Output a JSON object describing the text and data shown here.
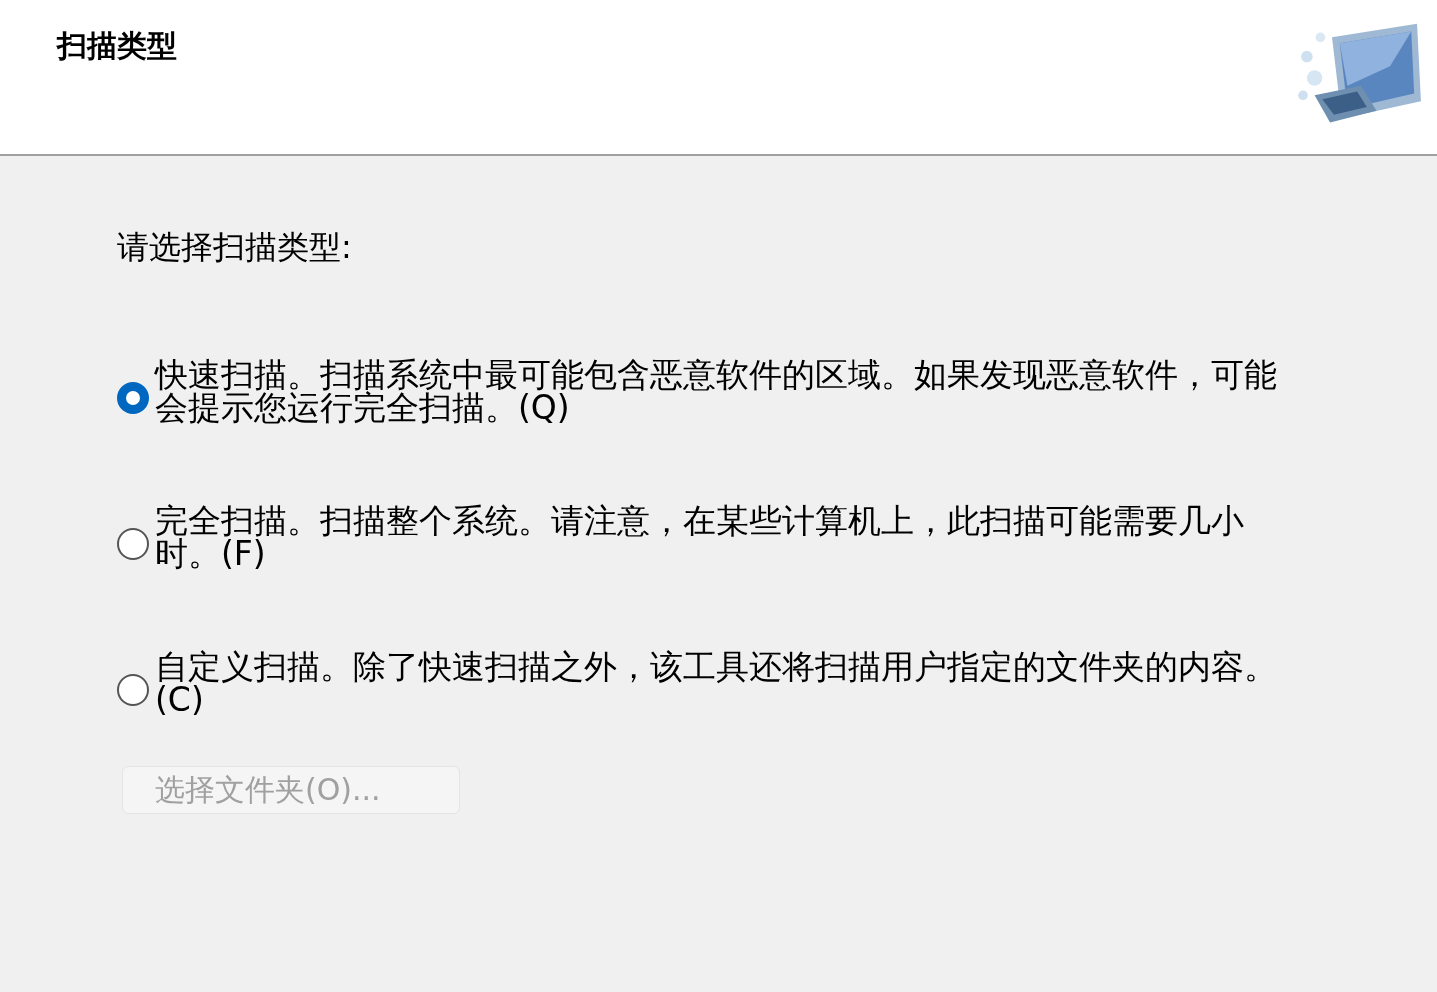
{
  "header": {
    "title": "扫描类型"
  },
  "prompt": "请选择扫描类型:",
  "options": [
    {
      "label": "快速扫描。扫描系统中最可能包含恶意软件的区域。如果发现恶意软件，可能会提示您运行完全扫描。(Q)",
      "selected": true
    },
    {
      "label": "完全扫描。扫描整个系统。请注意，在某些计算机上，此扫描可能需要几小时。(F)",
      "selected": false
    },
    {
      "label": "自定义扫描。除了快速扫描之外，该工具还将扫描用户指定的文件夹的内容。(C)",
      "selected": false
    }
  ],
  "folder_button": {
    "label": "选择文件夹(O)...",
    "disabled": true
  }
}
